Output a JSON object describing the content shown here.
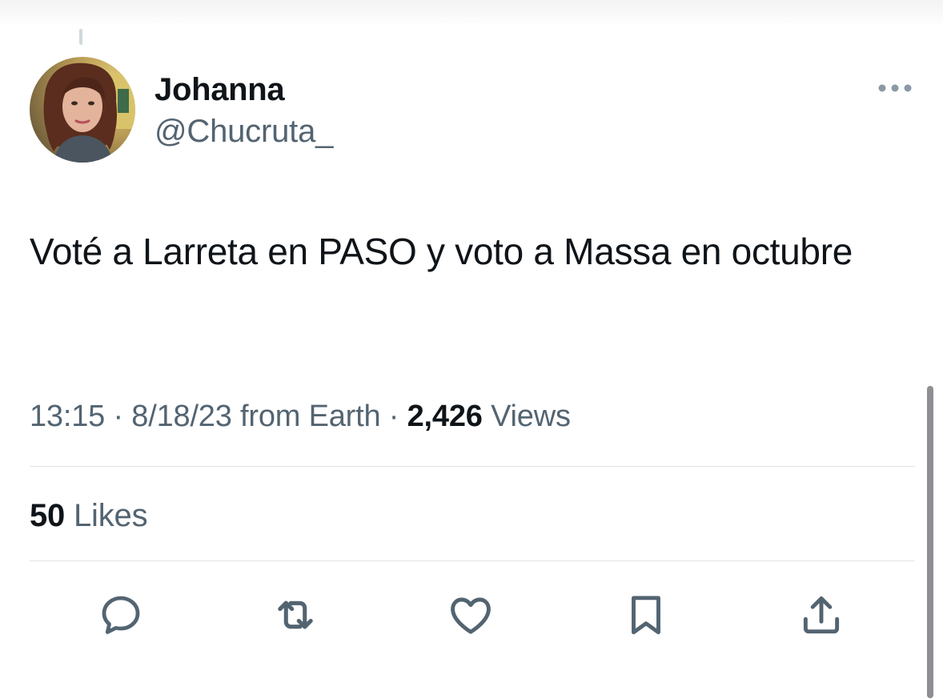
{
  "user": {
    "display_name": "Johanna",
    "handle": "@Chucruta_",
    "avatar_icon": "profile-photo"
  },
  "tweet": {
    "text": "Voté a Larreta en PASO y voto a Massa en octubre",
    "time": "13:15",
    "date": "8/18/23",
    "source": "from Earth",
    "separator": "·",
    "views_count": "2,426",
    "views_label": "Views"
  },
  "stats": {
    "likes_count": "50",
    "likes_label": "Likes"
  },
  "actions": [
    {
      "name": "reply",
      "icon": "reply-icon"
    },
    {
      "name": "retweet",
      "icon": "retweet-icon"
    },
    {
      "name": "like",
      "icon": "heart-icon"
    },
    {
      "name": "bookmark",
      "icon": "bookmark-icon"
    },
    {
      "name": "share",
      "icon": "share-icon"
    }
  ],
  "colors": {
    "text_primary": "#0f1419",
    "text_secondary": "#536471",
    "icon": "#536471",
    "divider": "#dfe3e6"
  }
}
